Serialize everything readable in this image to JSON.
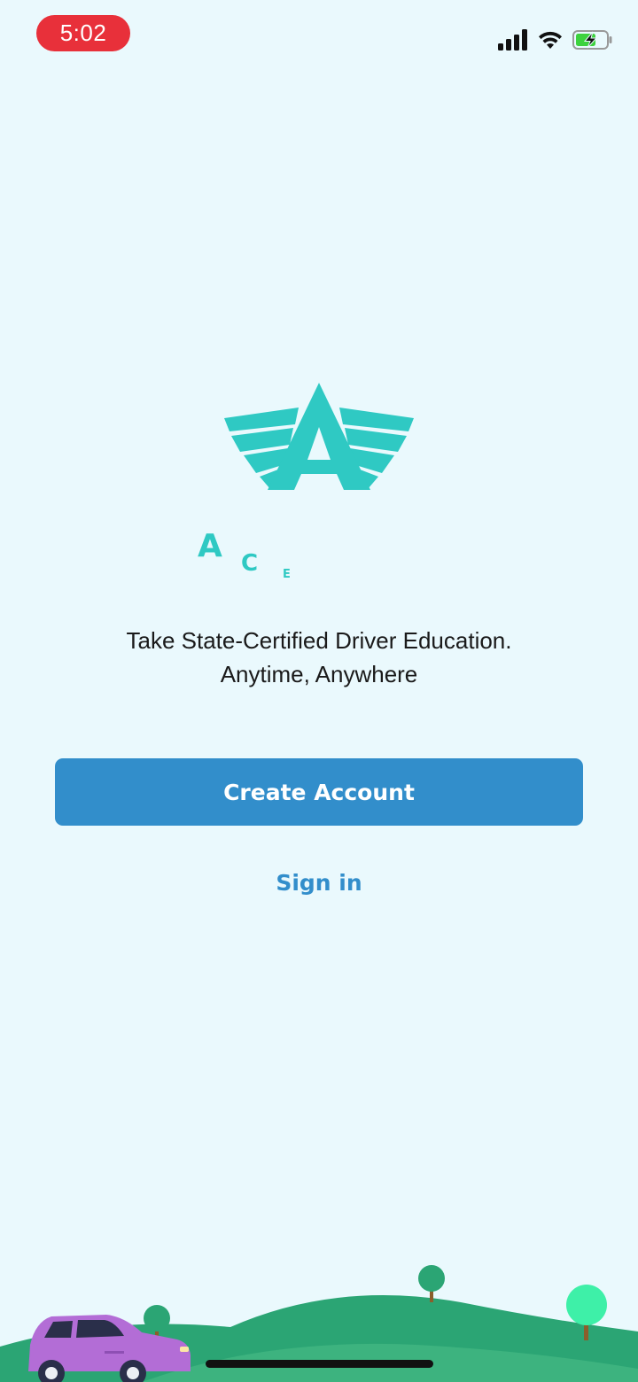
{
  "status_bar": {
    "time": "5:02",
    "icons": [
      "signal-icon",
      "wifi-icon",
      "battery-charging-icon"
    ]
  },
  "logo": {
    "icon": "winged-a-logo",
    "letters": [
      "A",
      "C",
      "E"
    ]
  },
  "tagline": {
    "line1": "Take State-Certified Driver Education.",
    "line2": "Anytime, Anywhere"
  },
  "actions": {
    "create_account": "Create Account",
    "sign_in": "Sign in"
  },
  "colors": {
    "background": "#EAF9FD",
    "brand_teal": "#2FC9C3",
    "primary_blue": "#328ECB",
    "time_pill_red": "#E8303A",
    "hill_green": "#2BA574",
    "car_purple": "#B36DD6"
  }
}
